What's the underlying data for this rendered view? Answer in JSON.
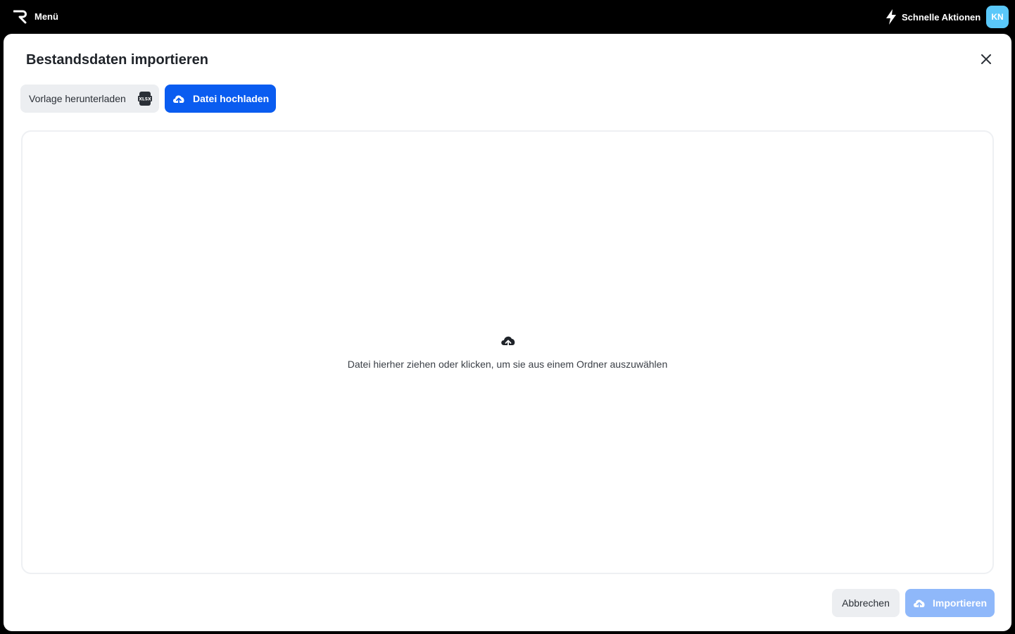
{
  "topbar": {
    "menu_label": "Menü",
    "quick_actions_label": "Schnelle Aktionen",
    "avatar_initials": "KN",
    "avatar_color": "#5ac8fa"
  },
  "modal": {
    "title": "Bestandsdaten importieren",
    "template_button_label": "Vorlage herunterladen",
    "template_icon": "xlsx-file-icon",
    "upload_button_label": "Datei hochladen",
    "dropzone_text": "Datei hierher ziehen oder klicken, um sie aus einem Ordner auszuwählen",
    "cancel_label": "Abbrechen",
    "import_label": "Importieren"
  },
  "colors": {
    "primary": "#0a5cf0",
    "primary_disabled": "#8fb8fa",
    "secondary_bg": "#eceef1"
  }
}
